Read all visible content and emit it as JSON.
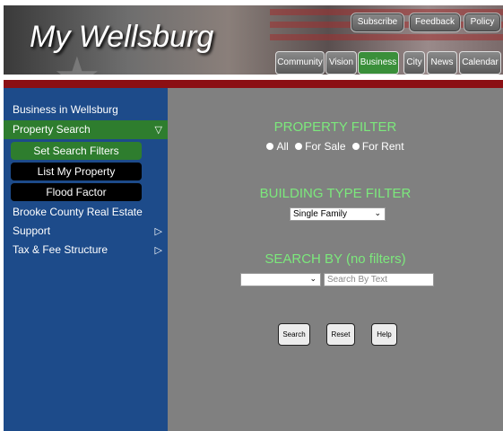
{
  "header": {
    "site_title": "My Wellsburg",
    "top_buttons": [
      "Subscribe",
      "Feedback",
      "Policy"
    ],
    "nav_tabs": [
      "Community",
      "Vision",
      "Business",
      "City",
      "News",
      "Calendar"
    ],
    "active_tab": "Business",
    "accent_green": "#3a8f3a",
    "bar_red": "#8b0f14"
  },
  "sidebar": {
    "items": [
      {
        "label": "Business in Wellsburg"
      },
      {
        "label": "Property Search",
        "arrow": "▽"
      },
      {
        "label": "Brooke County Real Estate"
      },
      {
        "label": "Support",
        "arrow": "▷"
      },
      {
        "label": "Tax & Fee Structure",
        "arrow": "▷"
      }
    ],
    "sub_items": [
      "Set Search Filters",
      "List My Property",
      "Flood Factor"
    ],
    "bg_color": "#1d4b8a"
  },
  "main": {
    "property_filter_heading": "PROPERTY FILTER",
    "radio_options": [
      "All",
      "For Sale",
      "For Rent"
    ],
    "building_type_heading": "BUILDING TYPE FILTER",
    "building_type_value": "Single Family",
    "search_by_heading": "SEARCH BY (no filters)",
    "search_by_value": "",
    "search_text_placeholder": "Search By Text",
    "buttons": [
      "Search",
      "Reset",
      "Help"
    ],
    "heading_color": "#7ce87c"
  }
}
